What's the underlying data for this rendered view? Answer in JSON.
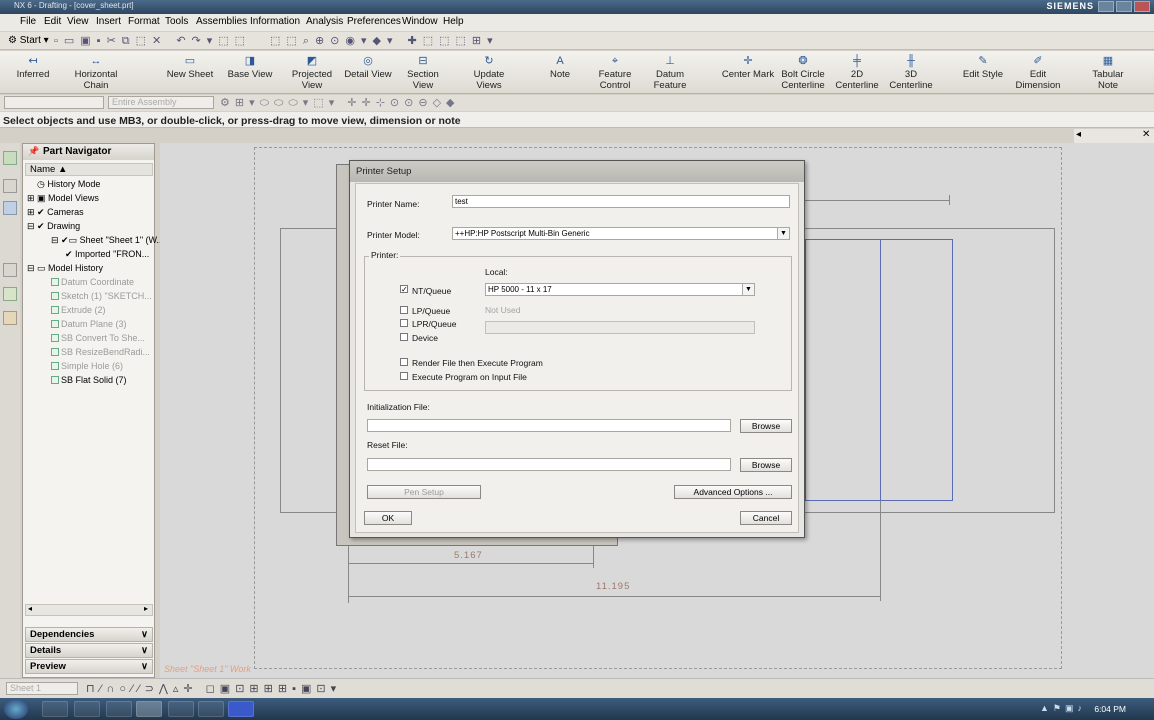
{
  "window": {
    "title": "NX 6 - Drafting - [cover_sheet.prt]",
    "brand": "SIEMENS"
  },
  "menu": [
    "File",
    "Edit",
    "View",
    "Insert",
    "Format",
    "Tools",
    "Assemblies",
    "Information",
    "Analysis",
    "Preferences",
    "Window",
    "Help"
  ],
  "stdbar": {
    "start_label": "Start"
  },
  "drafting_toolbar": [
    {
      "label": "Inferred",
      "icon": "dimension-inferred-icon"
    },
    {
      "label": "Horizontal Chain",
      "icon": "horizontal-chain-icon"
    },
    {
      "label": "New Sheet",
      "icon": "new-sheet-icon"
    },
    {
      "label": "Base View",
      "icon": "base-view-icon"
    },
    {
      "label": "Projected View",
      "icon": "projected-view-icon"
    },
    {
      "label": "Detail View",
      "icon": "detail-view-icon"
    },
    {
      "label": "Section View",
      "icon": "section-view-icon"
    },
    {
      "label": "Update Views",
      "icon": "update-views-icon"
    },
    {
      "label": "Note",
      "icon": "note-icon"
    },
    {
      "label": "Feature Control",
      "icon": "feature-control-icon"
    },
    {
      "label": "Datum Feature",
      "icon": "datum-feature-icon"
    },
    {
      "label": "Center Mark",
      "icon": "center-mark-icon"
    },
    {
      "label": "Bolt Circle Centerline",
      "icon": "bolt-circle-icon"
    },
    {
      "label": "2D Centerline",
      "icon": "centerline-2d-icon"
    },
    {
      "label": "3D Centerline",
      "icon": "centerline-3d-icon"
    },
    {
      "label": "Edit Style",
      "icon": "edit-style-icon"
    },
    {
      "label": "Edit Dimension",
      "icon": "edit-dimension-icon"
    },
    {
      "label": "Tabular Note",
      "icon": "tabular-note-icon"
    }
  ],
  "selection": {
    "filter": "",
    "scope": "Entire Assembly"
  },
  "cue_line": "Select objects and use MB3, or double-click, or press-drag to move view, dimension or note",
  "navigator": {
    "title": "Part Navigator",
    "column": "Name",
    "items": [
      {
        "label": "History Mode",
        "indent": 0,
        "dim": false
      },
      {
        "label": "Model Views",
        "indent": 0,
        "dim": false
      },
      {
        "label": "Cameras",
        "indent": 0,
        "dim": false
      },
      {
        "label": "Drawing",
        "indent": 0,
        "dim": false
      },
      {
        "label": "Sheet \"Sheet 1\" (W...",
        "indent": 1,
        "dim": false
      },
      {
        "label": "Imported \"FRON...",
        "indent": 2,
        "dim": false
      },
      {
        "label": "Model History",
        "indent": 0,
        "dim": false
      },
      {
        "label": "Datum Coordinate",
        "indent": 1,
        "dim": true
      },
      {
        "label": "Sketch (1) \"SKETCH...",
        "indent": 1,
        "dim": true
      },
      {
        "label": "Extrude (2)",
        "indent": 1,
        "dim": true
      },
      {
        "label": "Datum Plane (3)",
        "indent": 1,
        "dim": true
      },
      {
        "label": "SB Convert To She...",
        "indent": 1,
        "dim": true
      },
      {
        "label": "SB ResizeBendRadi...",
        "indent": 1,
        "dim": true
      },
      {
        "label": "Simple Hole (6)",
        "indent": 1,
        "dim": true
      },
      {
        "label": "SB Flat Solid (7)",
        "indent": 1,
        "dim": false
      }
    ],
    "panels": [
      "Dependencies",
      "Details",
      "Preview"
    ]
  },
  "canvas": {
    "dim1": "5.167",
    "dim2": "11.195",
    "sheet_label": "Sheet \"Sheet 1\" Work"
  },
  "dialog": {
    "title": "Printer Setup",
    "printer_name_label": "Printer Name:",
    "printer_name": "test",
    "printer_model_label": "Printer Model:",
    "printer_model": "++HP:HP Postscript Multi-Bin Generic",
    "group_label": "Printer:",
    "local_label": "Local:",
    "local_value": "HP 5000 - 11 x 17",
    "not_used": "Not Used",
    "nt_queue": "NT/Queue",
    "lp_queue": "LP/Queue",
    "lpr_queue": "LPR/Queue",
    "device": "Device",
    "render_file": "Render File then Execute Program",
    "execute_program": "Execute Program on Input File",
    "init_file_label": "Initialization File:",
    "reset_file_label": "Reset File:",
    "browse": "Browse",
    "pen_setup": "Pen Setup",
    "advanced": "Advanced Options ...",
    "ok": "OK",
    "cancel": "Cancel"
  },
  "statusbar": {
    "sheet": "Sheet 1"
  },
  "taskbar": {
    "time": "6:04 PM"
  }
}
